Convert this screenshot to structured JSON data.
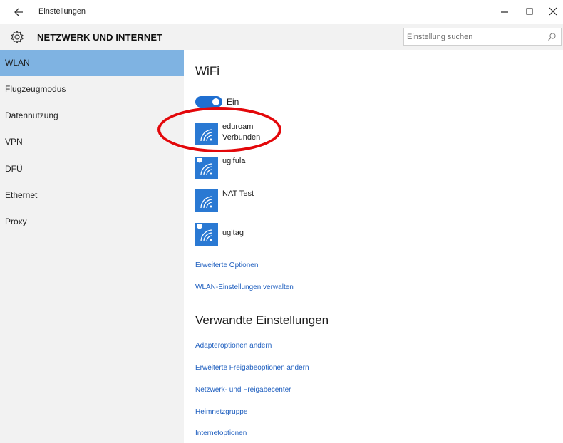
{
  "window": {
    "title": "Einstellungen"
  },
  "header": {
    "section_title": "NETZWERK UND INTERNET",
    "search_placeholder": "Einstellung suchen"
  },
  "sidebar": {
    "items": [
      {
        "label": "WLAN",
        "active": true
      },
      {
        "label": "Flugzeugmodus",
        "active": false
      },
      {
        "label": "Datennutzung",
        "active": false
      },
      {
        "label": "VPN",
        "active": false
      },
      {
        "label": "DFÜ",
        "active": false
      },
      {
        "label": "Ethernet",
        "active": false
      },
      {
        "label": "Proxy",
        "active": false
      }
    ]
  },
  "main": {
    "heading": "WiFi",
    "toggle": {
      "label": "Ein",
      "on": true
    },
    "networks": [
      {
        "name": "eduroam",
        "status": "Verbunden",
        "secured": false
      },
      {
        "name": "ugifula",
        "status": "",
        "secured": true
      },
      {
        "name": "NAT Test",
        "status": "",
        "secured": false
      },
      {
        "name": "ugitag",
        "status": "",
        "secured": true
      }
    ],
    "links": [
      "Erweiterte Optionen",
      "WLAN-Einstellungen verwalten"
    ],
    "related_heading": "Verwandte Einstellungen",
    "related_links": [
      "Adapteroptionen ändern",
      "Erweiterte Freigabeoptionen ändern",
      "Netzwerk- und Freigabecenter",
      "Heimnetzgruppe",
      "Internetoptionen"
    ]
  },
  "colors": {
    "accent": "#2a79d3",
    "sidebar_active": "#7fb3e2",
    "link": "#1f5fbf",
    "highlight": "#e3070a"
  }
}
